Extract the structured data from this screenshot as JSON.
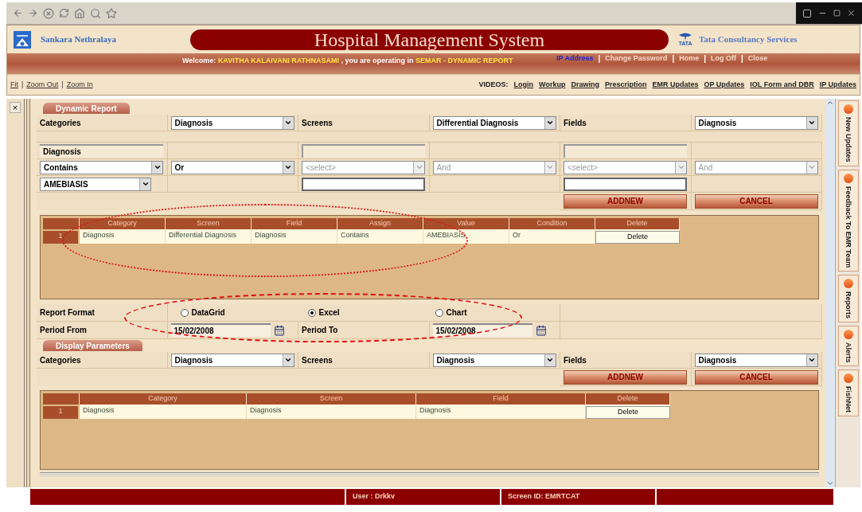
{
  "header": {
    "left_org": "Sankara Nethralaya",
    "title": "Hospital Management System",
    "right_logo_text": "TATA",
    "right_org": "Tata Consultancy Services"
  },
  "welcome": {
    "prefix": "Welcome:",
    "user": "KAVITHA KALAIVANI RATHNASAMI",
    "middle": ", you are operating in",
    "module": "SEMAR -",
    "screen": "DYNAMIC REPORT"
  },
  "header_links": [
    "IP Address",
    "Change Password",
    "Home",
    "Log Off",
    "Close"
  ],
  "link_separator": "|",
  "zoom_links": [
    "Fit",
    "Zoom Out",
    "Zoom In"
  ],
  "videos": {
    "label": "VIDEOS:",
    "links": [
      "Login",
      "Workup",
      "Drawing",
      "Prescription",
      "EMR Updates",
      "OP Updates",
      "IOL Form and DBR",
      "IP Updates"
    ]
  },
  "close_pane": "×",
  "dynamic_report": {
    "title": "Dynamic Report",
    "selectors": [
      {
        "label": "Categories",
        "value": "Diagnosis"
      },
      {
        "label": "Screens",
        "value": "Differential Diagnosis"
      },
      {
        "label": "Fields",
        "value": "Diagnosis"
      }
    ],
    "conditions": [
      {
        "field": "Diagnosis",
        "operator": {
          "value": "Contains",
          "disabled": false
        },
        "join": {
          "value": "Or",
          "disabled": false
        },
        "value": {
          "kind": "select",
          "text": "AMEBIASIS"
        }
      },
      {
        "operator": {
          "value": "<select>",
          "disabled": true
        },
        "join": {
          "value": "And",
          "disabled": true
        },
        "value": {
          "kind": "input"
        }
      },
      {
        "operator": {
          "value": "<select>",
          "disabled": true
        },
        "join": {
          "value": "And",
          "disabled": true
        },
        "value": {
          "kind": "input"
        }
      }
    ],
    "buttons": [
      "ADDNEW",
      "CANCEL"
    ],
    "table": {
      "columns": [
        "Category",
        "Screen",
        "Field",
        "Assign",
        "Value",
        "Condition",
        "Delete"
      ],
      "rows": [
        {
          "index": "1",
          "cells": [
            "Diagnosis",
            "Differential Diagnosis",
            "Diagnosis",
            "Contains",
            "AMEBIASIS",
            "Or"
          ],
          "delete": "Delete"
        }
      ]
    }
  },
  "report_format": {
    "label": "Report Format",
    "options": [
      {
        "label": "DataGrid",
        "selected": false
      },
      {
        "label": "Excel",
        "selected": true
      },
      {
        "label": "Chart",
        "selected": false
      }
    ]
  },
  "period": {
    "from_label": "Period From",
    "from": "15/02/2008",
    "to_label": "Period To",
    "to": "15/02/2008"
  },
  "display_parameters": {
    "title": "Display Parameters",
    "selectors": [
      {
        "label": "Categories",
        "value": "Diagnosis"
      },
      {
        "label": "Screens",
        "value": "Diagnosis"
      },
      {
        "label": "Fields",
        "value": "Diagnosis"
      }
    ],
    "buttons": [
      "ADDNEW",
      "CANCEL"
    ],
    "table": {
      "columns": [
        "Category",
        "Screen",
        "Field",
        "Delete"
      ],
      "rows": [
        {
          "index": "1",
          "cells": [
            "Diagnosis",
            "Diagnosis",
            "Diagnosis"
          ],
          "delete": "Delete"
        }
      ]
    }
  },
  "side_tabs": [
    "New Updates",
    "Feedback To EMR Team",
    "Reports",
    "Alerts",
    "FishNet"
  ],
  "status_bar": [
    "User : Drkkv",
    "Screen ID: EMRTCAT"
  ],
  "annotations": [
    {
      "kind": "dotted"
    },
    {
      "kind": "dashed"
    }
  ]
}
